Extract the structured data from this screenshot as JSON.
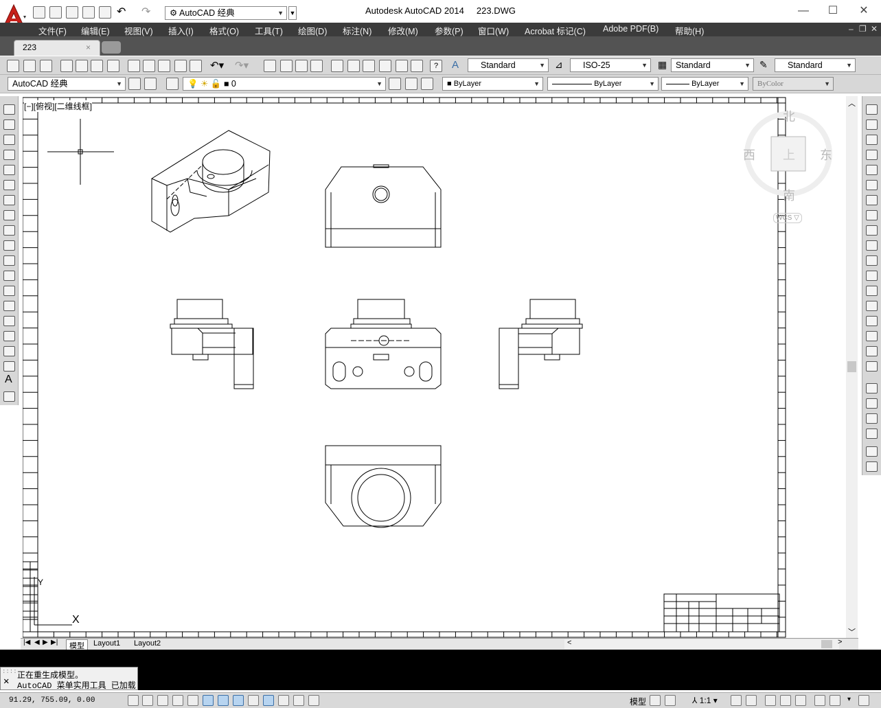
{
  "app": {
    "title": "Autodesk AutoCAD 2014",
    "filename": "223.DWG",
    "workspace": "AutoCAD 经典",
    "workspace_toolbar": "AutoCAD 经典"
  },
  "menus": [
    "文件(F)",
    "编辑(E)",
    "视图(V)",
    "插入(I)",
    "格式(O)",
    "工具(T)",
    "绘图(D)",
    "标注(N)",
    "修改(M)",
    "参数(P)",
    "窗口(W)",
    "Acrobat 标记(C)",
    "Adobe PDF(B)",
    "帮助(H)"
  ],
  "doc_tab": {
    "label": "223",
    "close": "×"
  },
  "styles": {
    "text_style": "Standard",
    "dim_style": "ISO-25",
    "table_style": "Standard",
    "mleader_style": "Standard"
  },
  "layers": {
    "current_layer": "0",
    "color": "ByLayer",
    "linetype": "ByLayer",
    "lineweight": "ByLayer",
    "plotstyle": "ByColor"
  },
  "viewport": {
    "label": "[−][俯视][二维线框]"
  },
  "viewcube": {
    "north": "北",
    "south": "南",
    "east": "东",
    "west": "西",
    "top_face": "上",
    "wcs": "WCS"
  },
  "ucs": {
    "y": "Y",
    "x": "X"
  },
  "layout_tabs": [
    "模型",
    "Layout1",
    "Layout2"
  ],
  "command_history": [
    "正在重生成模型。",
    "AutoCAD 菜单实用工具 已加载"
  ],
  "status": {
    "coords": "91.29,  755.09, 0.00",
    "model_label": "模型",
    "annotation_scale": "1:1"
  },
  "colors": {
    "menubar": "#3b3b3b",
    "tabbar": "#535353",
    "toolbar": "#d7d7d7",
    "autocad_red": "#c8201a"
  }
}
